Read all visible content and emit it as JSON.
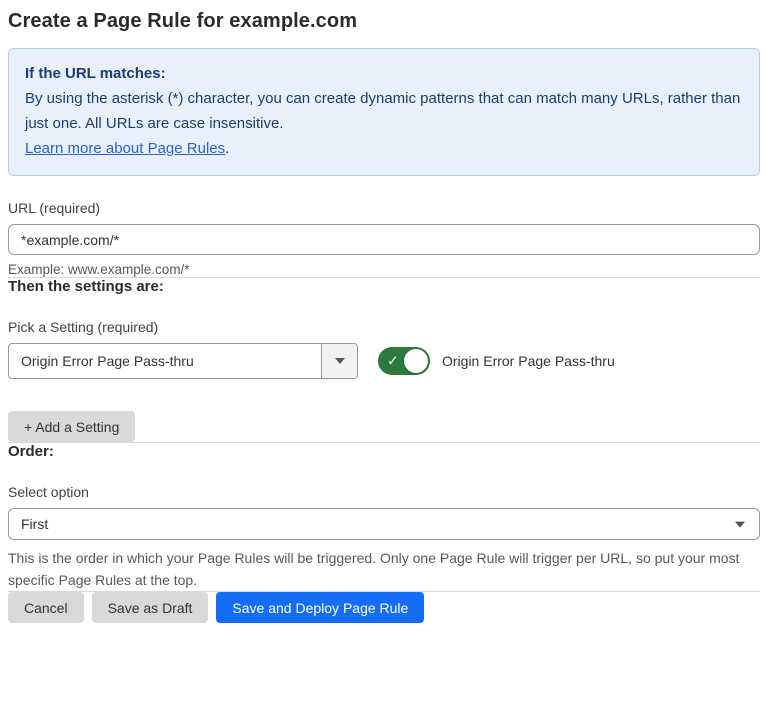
{
  "page": {
    "title": "Create a Page Rule for example.com"
  },
  "info_box": {
    "heading": "If the URL matches:",
    "body": "By using the asterisk (*) character, you can create dynamic patterns that can match many URLs, rather than just one. All URLs are case insensitive.",
    "link_label": "Learn more about Page Rules",
    "link_suffix": "."
  },
  "url_field": {
    "label": "URL (required)",
    "value": "*example.com/*",
    "helper": "Example: www.example.com/*"
  },
  "settings_section": {
    "heading": "Then the settings are:",
    "picker_label": "Pick a Setting (required)",
    "picker_value": "Origin Error Page Pass-thru",
    "toggle_on": true,
    "toggle_label": "Origin Error Page Pass-thru",
    "add_setting_label": "+ Add a Setting"
  },
  "order_section": {
    "heading": "Order:",
    "select_label": "Select option",
    "select_value": "First",
    "helper": "This is the order in which your Page Rules will be triggered. Only one Page Rule will trigger per URL, so put your most specific Page Rules at the top."
  },
  "footer": {
    "cancel_label": "Cancel",
    "save_draft_label": "Save as Draft",
    "save_deploy_label": "Save and Deploy Page Rule"
  },
  "icons": {
    "toggle_check": "✓"
  },
  "colors": {
    "info_bg": "#e8f1fb",
    "info_border": "#abc9ec",
    "info_text": "#1d3d6d",
    "link_blue": "#2b62c9",
    "toggle_green": "#2c7a3e",
    "primary_blue": "#146ef5",
    "button_gray": "#d9d9d9",
    "divider_gray": "#d9d9d9"
  }
}
